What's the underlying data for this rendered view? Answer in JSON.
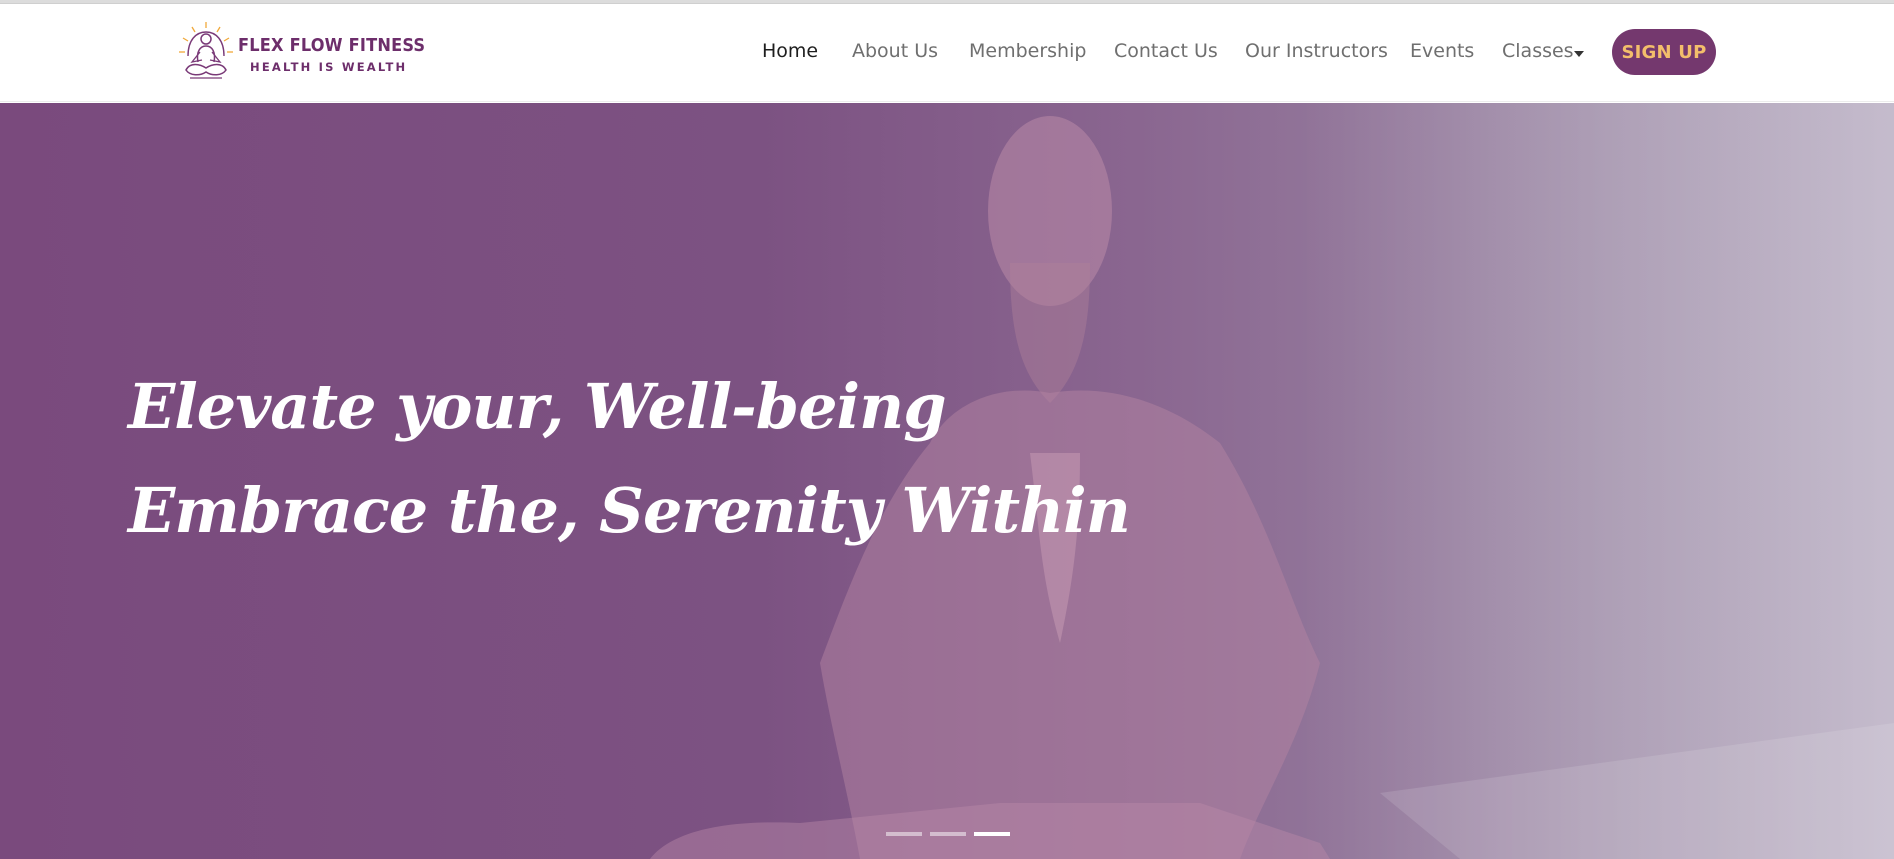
{
  "brand": {
    "name": "FLEX FLOW FITNESS",
    "tagline": "HEALTH IS WEALTH"
  },
  "nav": {
    "items": [
      {
        "label": "Home",
        "active": true
      },
      {
        "label": "About Us"
      },
      {
        "label": "Membership"
      },
      {
        "label": "Contact Us"
      },
      {
        "label": "Our Instructors"
      },
      {
        "label": "Events"
      },
      {
        "label": "Classes"
      }
    ],
    "signup_label": "SIGN UP"
  },
  "hero": {
    "line1": "Elevate your, Well-being",
    "line2": "Embrace the, Serenity Within",
    "slides_total": 3,
    "active_slide": 3
  },
  "colors": {
    "brand_purple": "#74386e",
    "signup_text": "#f3be6b",
    "hero_overlay": "#7a4a7d"
  }
}
